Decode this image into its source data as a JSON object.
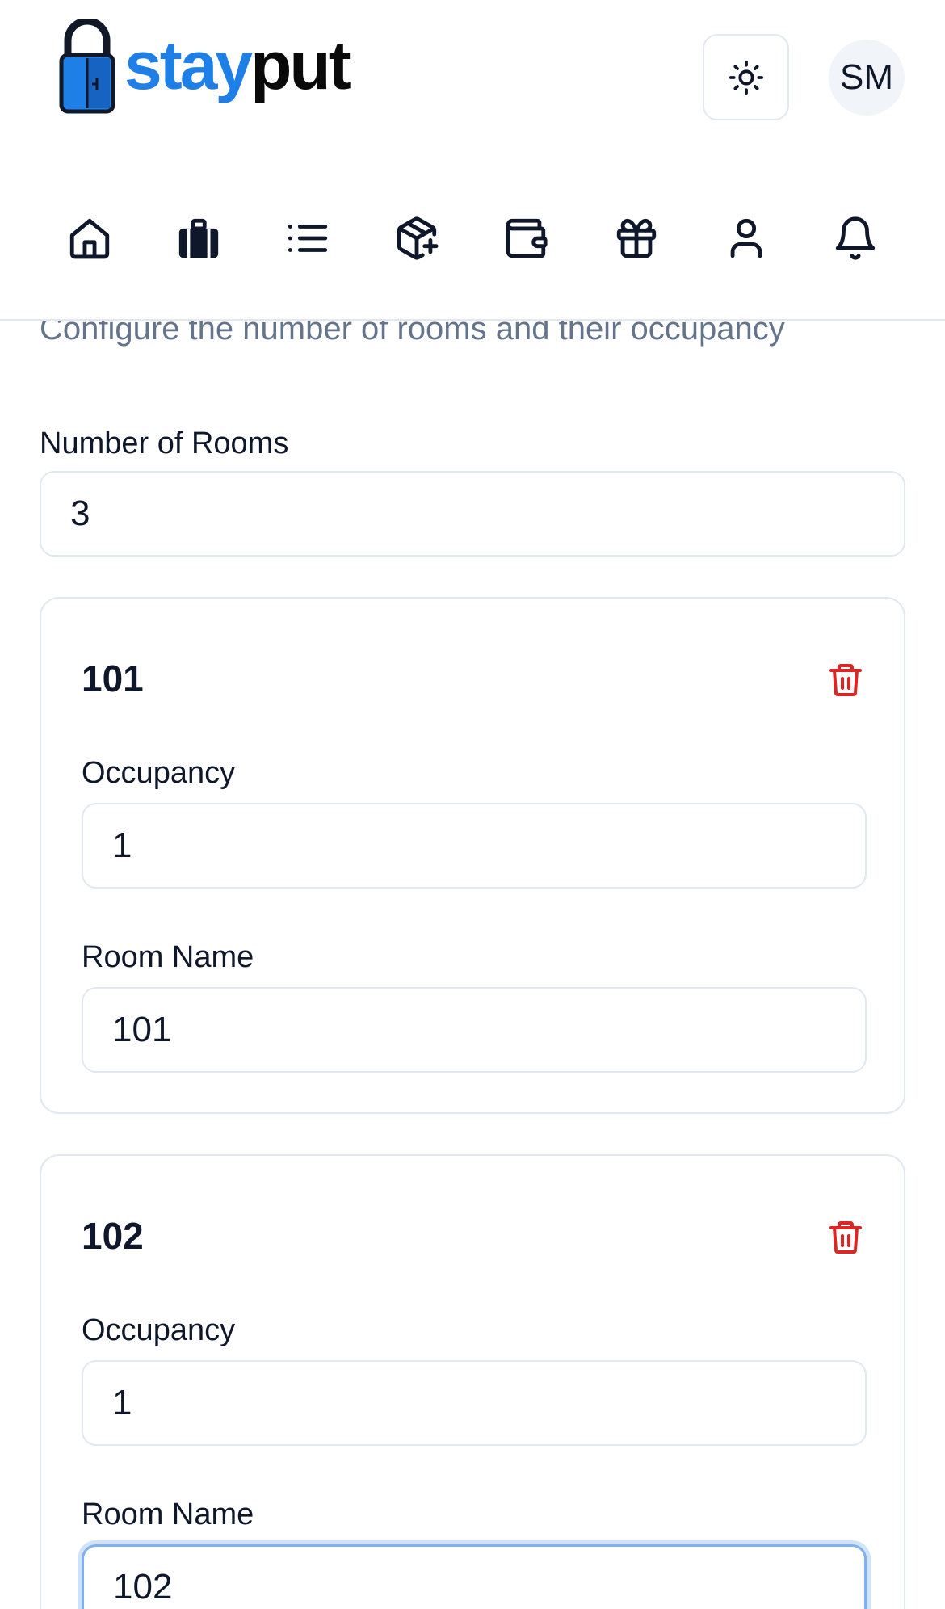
{
  "brand": {
    "name_part1": "stay",
    "name_part2": "put"
  },
  "user": {
    "initials": "SM"
  },
  "nav": {
    "items": [
      {
        "icon": "home-icon"
      },
      {
        "icon": "luggage-icon"
      },
      {
        "icon": "list-icon"
      },
      {
        "icon": "package-plus-icon"
      },
      {
        "icon": "wallet-icon"
      },
      {
        "icon": "gift-icon"
      },
      {
        "icon": "user-icon"
      },
      {
        "icon": "bell-icon"
      }
    ]
  },
  "page": {
    "subtitle": "Configure the number of rooms and their occupancy",
    "num_rooms_label": "Number of Rooms",
    "num_rooms_value": "3"
  },
  "rooms": [
    {
      "title": "101",
      "occupancy_label": "Occupancy",
      "occupancy": "1",
      "name_label": "Room Name",
      "name": "101"
    },
    {
      "title": "102",
      "occupancy_label": "Occupancy",
      "occupancy": "1",
      "name_label": "Room Name",
      "name": "102"
    }
  ],
  "colors": {
    "brand_blue": "#1e7fe6",
    "danger": "#dc2626",
    "muted": "#64748b",
    "border": "#e2e8f0",
    "focus": "#7fb0f0"
  }
}
